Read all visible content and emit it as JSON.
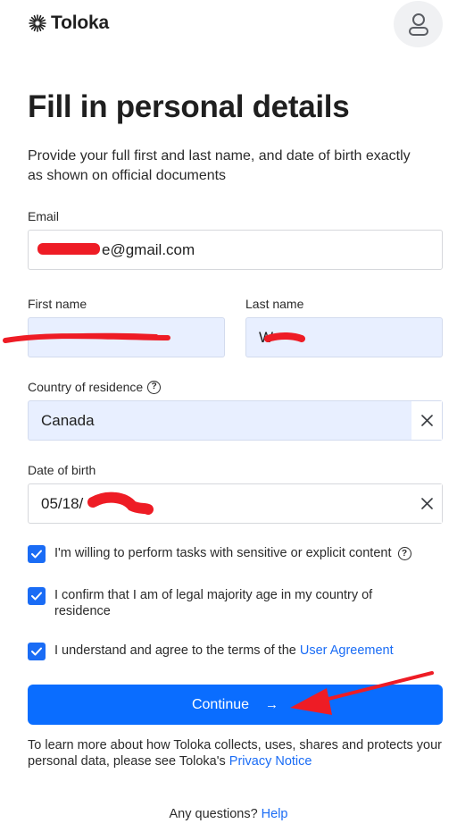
{
  "header": {
    "logo_text": "Toloka",
    "logo_icon": "sunburst-icon",
    "avatar_icon": "user-icon"
  },
  "page": {
    "title": "Fill in personal details",
    "subtitle": "Provide your full first and last name, and date of birth exactly as shown on official documents"
  },
  "form": {
    "email": {
      "label": "Email",
      "value": "e@gmail.com"
    },
    "first_name": {
      "label": "First name",
      "value": ""
    },
    "last_name": {
      "label": "Last name",
      "value": "W"
    },
    "country": {
      "label": "Country of residence",
      "value": "Canada"
    },
    "dob": {
      "label": "Date of birth",
      "value": "05/18/"
    }
  },
  "checkboxes": [
    {
      "label": "I'm willing to perform tasks with sensitive or explicit content",
      "checked": true
    },
    {
      "label": "I confirm that I am of legal majority age in my country of residence",
      "checked": true
    },
    {
      "label_prefix": "I understand and agree to the terms of the ",
      "link": "User Agreement",
      "checked": true
    }
  ],
  "actions": {
    "continue_label": "Continue",
    "continue_arrow": "→"
  },
  "footer": {
    "privacy_text": "To learn more about how Toloka collects, uses, shares and protects your personal data, please see Toloka's ",
    "privacy_link": "Privacy Notice",
    "questions_text": "Any questions? ",
    "help_link": "Help"
  },
  "colors": {
    "accent": "#0a6dff",
    "field_fill": "#e8efff",
    "annotation": "#ee1c25"
  }
}
